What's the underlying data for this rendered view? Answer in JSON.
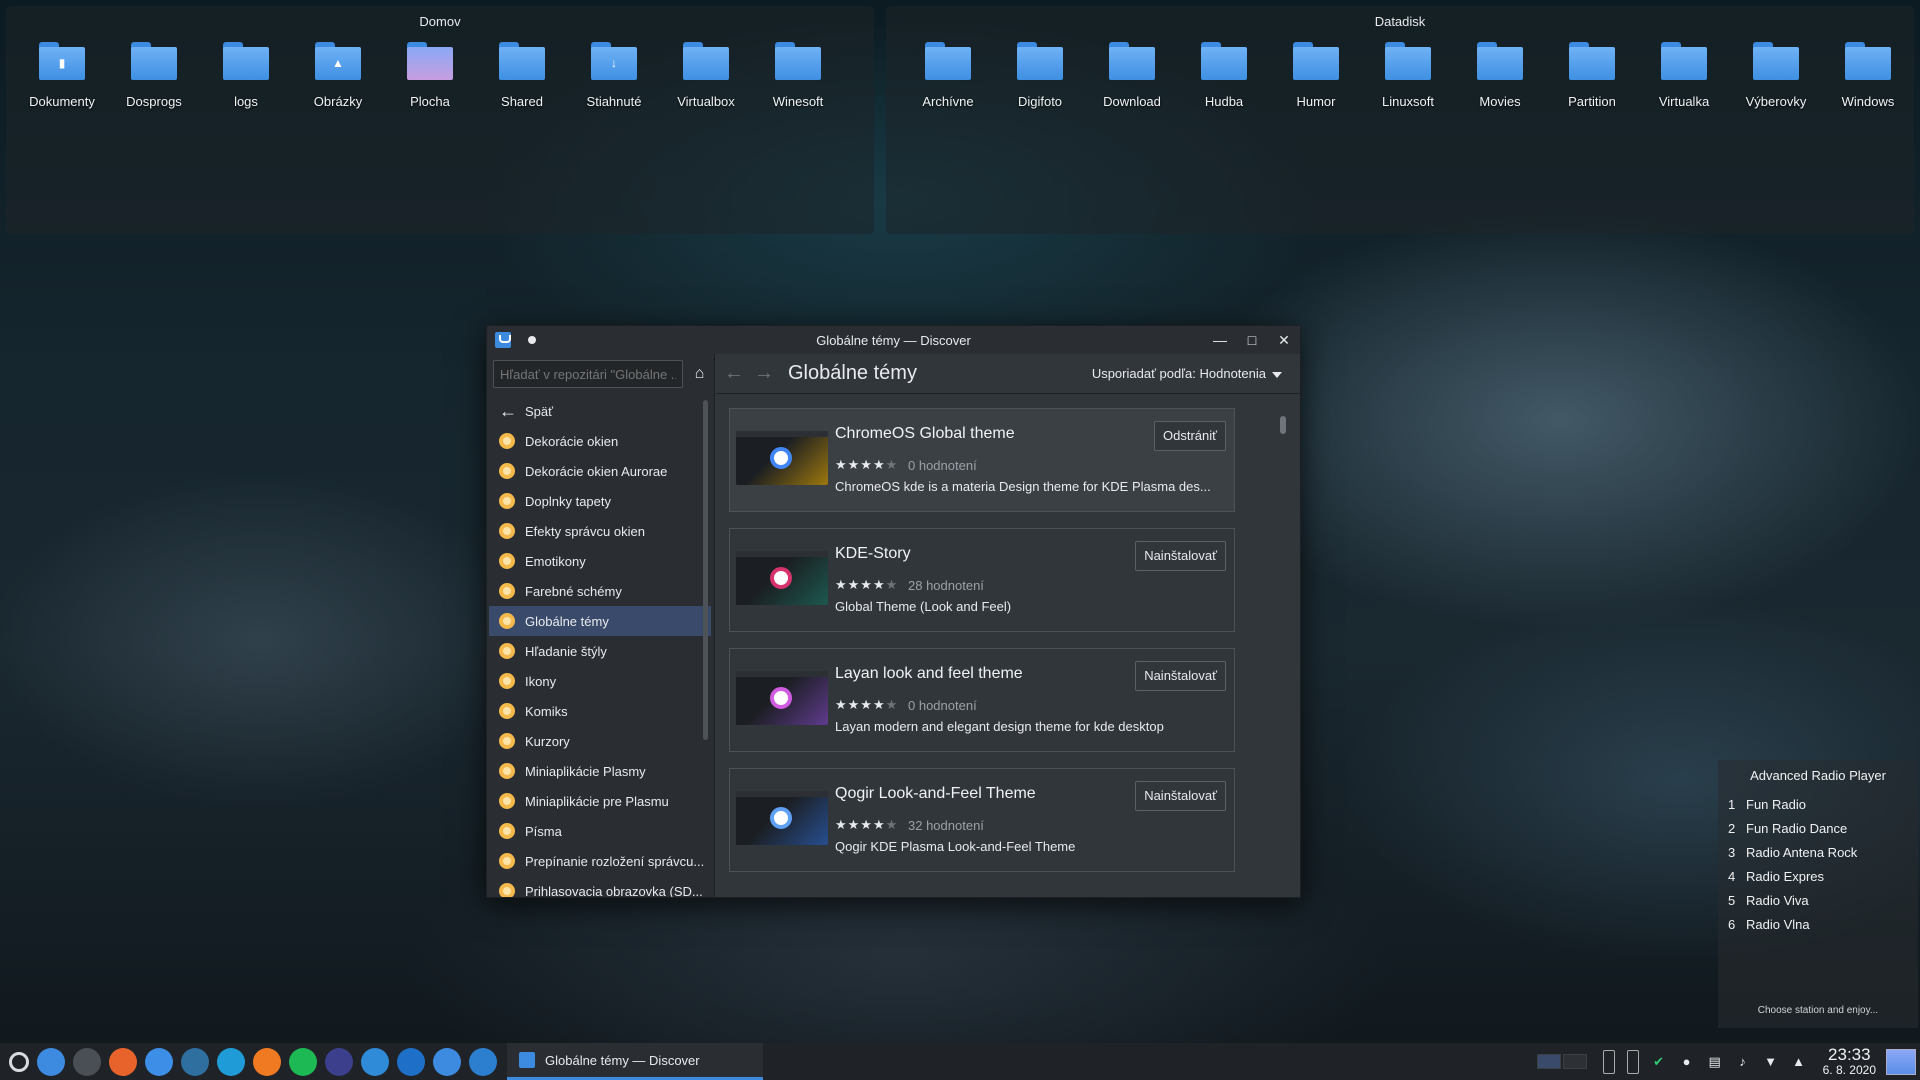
{
  "desktop": {
    "panels": [
      {
        "title": "Domov",
        "items": [
          {
            "label": "Dokumenty",
            "glyph": "▮"
          },
          {
            "label": "Dosprogs",
            "glyph": ""
          },
          {
            "label": "logs",
            "glyph": ""
          },
          {
            "label": "Obrázky",
            "glyph": "▲"
          },
          {
            "label": "Plocha",
            "glyph": ""
          },
          {
            "label": "Shared",
            "glyph": ""
          },
          {
            "label": "Stiahnuté",
            "glyph": "↓"
          },
          {
            "label": "Virtualbox",
            "glyph": ""
          },
          {
            "label": "Winesoft",
            "glyph": ""
          }
        ]
      },
      {
        "title": "Datadisk",
        "items": [
          {
            "label": "Archívne"
          },
          {
            "label": "Digifoto"
          },
          {
            "label": "Download"
          },
          {
            "label": "Hudba"
          },
          {
            "label": "Humor"
          },
          {
            "label": "Linuxsoft"
          },
          {
            "label": "Movies"
          },
          {
            "label": "Partition"
          },
          {
            "label": "Virtualka"
          },
          {
            "label": "Výberovky"
          },
          {
            "label": "Windows"
          }
        ]
      }
    ]
  },
  "window": {
    "title": "Globálne témy — Discover",
    "search_placeholder": "Hľadať v repozitári \"Globálne ...",
    "back_label": "Späť",
    "categories": [
      "Dekorácie okien",
      "Dekorácie okien Aurorae",
      "Doplnky tapety",
      "Efekty správcu okien",
      "Emotikony",
      "Farebné schémy",
      "Globálne témy",
      "Hľadanie štýly",
      "Ikony",
      "Komiks",
      "Kurzory",
      "Miniaplikácie Plasmy",
      "Miniaplikácie pre Plasmu",
      "Písma",
      "Prepínanie rozložení správcu...",
      "Prihlasovacia obrazovka (SD..."
    ],
    "active_category": "Globálne témy",
    "page_title": "Globálne témy",
    "sort_label": "Usporiadať podľa: Hodnotenia",
    "cards": [
      {
        "name": "ChromeOS Global theme",
        "stars": "★★★★",
        "stars_dim": "★",
        "ratings": "0 hodnotení",
        "desc": "ChromeOS kde is a materia Design theme for KDE Plasma des...",
        "button": "Odstrániť",
        "thumb_color": "#f4b400",
        "accent": "#4285f4"
      },
      {
        "name": "KDE-Story",
        "stars": "★★★★",
        "stars_dim": "★",
        "ratings": "28 hodnotení",
        "desc": "Global Theme (Look and Feel)",
        "button": "Nainštalovať",
        "thumb_color": "#1e7f6e",
        "accent": "#d6336c"
      },
      {
        "name": "Layan look and feel theme",
        "stars": "★★★★",
        "stars_dim": "★",
        "ratings": "0 hodnotení",
        "desc": "Layan modern and elegant design theme for kde desktop",
        "button": "Nainštalovať",
        "thumb_color": "#8e4ed6",
        "accent": "#d05ce0"
      },
      {
        "name": "Qogir Look-and-Feel Theme",
        "stars": "★★★★",
        "stars_dim": "★",
        "ratings": "32 hodnotení",
        "desc": " Qogir KDE Plasma Look-and-Feel Theme",
        "button": "Nainštalovať",
        "thumb_color": "#2f6fdb",
        "accent": "#5fa0f5"
      }
    ]
  },
  "radio": {
    "title": "Advanced Radio Player",
    "stations": [
      {
        "num": "1",
        "name": "Fun Radio"
      },
      {
        "num": "2",
        "name": "Fun Radio Dance"
      },
      {
        "num": "3",
        "name": "Radio Antena Rock"
      },
      {
        "num": "4",
        "name": "Radio Expres"
      },
      {
        "num": "5",
        "name": "Radio Viva"
      },
      {
        "num": "6",
        "name": "Radio Vlna"
      }
    ],
    "footer": "Choose station and enjoy..."
  },
  "taskbar": {
    "launchers": [
      {
        "name": "files-icon",
        "color": "#3d8be0"
      },
      {
        "name": "terminal-icon",
        "color": "#4a4f55"
      },
      {
        "name": "firefox-icon",
        "color": "#e8632b"
      },
      {
        "name": "chromium-icon",
        "color": "#3c8ee6"
      },
      {
        "name": "lutris-icon",
        "color": "#2f6fa0"
      },
      {
        "name": "kodi-icon",
        "color": "#1f9cd8"
      },
      {
        "name": "software-icon",
        "color": "#f07a22"
      },
      {
        "name": "spotify-icon",
        "color": "#1db954"
      },
      {
        "name": "monitor-icon",
        "color": "#3b3f8c"
      },
      {
        "name": "chat-icon",
        "color": "#2f8ad8"
      },
      {
        "name": "virtualbox-icon",
        "color": "#1e6fc8"
      },
      {
        "name": "discover-icon",
        "color": "#3d8be0"
      },
      {
        "name": "cloud-icon",
        "color": "#2c7fcf"
      }
    ],
    "task_label": "Globálne témy — Discover",
    "time": "23:33",
    "date": "6. 8. 2020"
  }
}
